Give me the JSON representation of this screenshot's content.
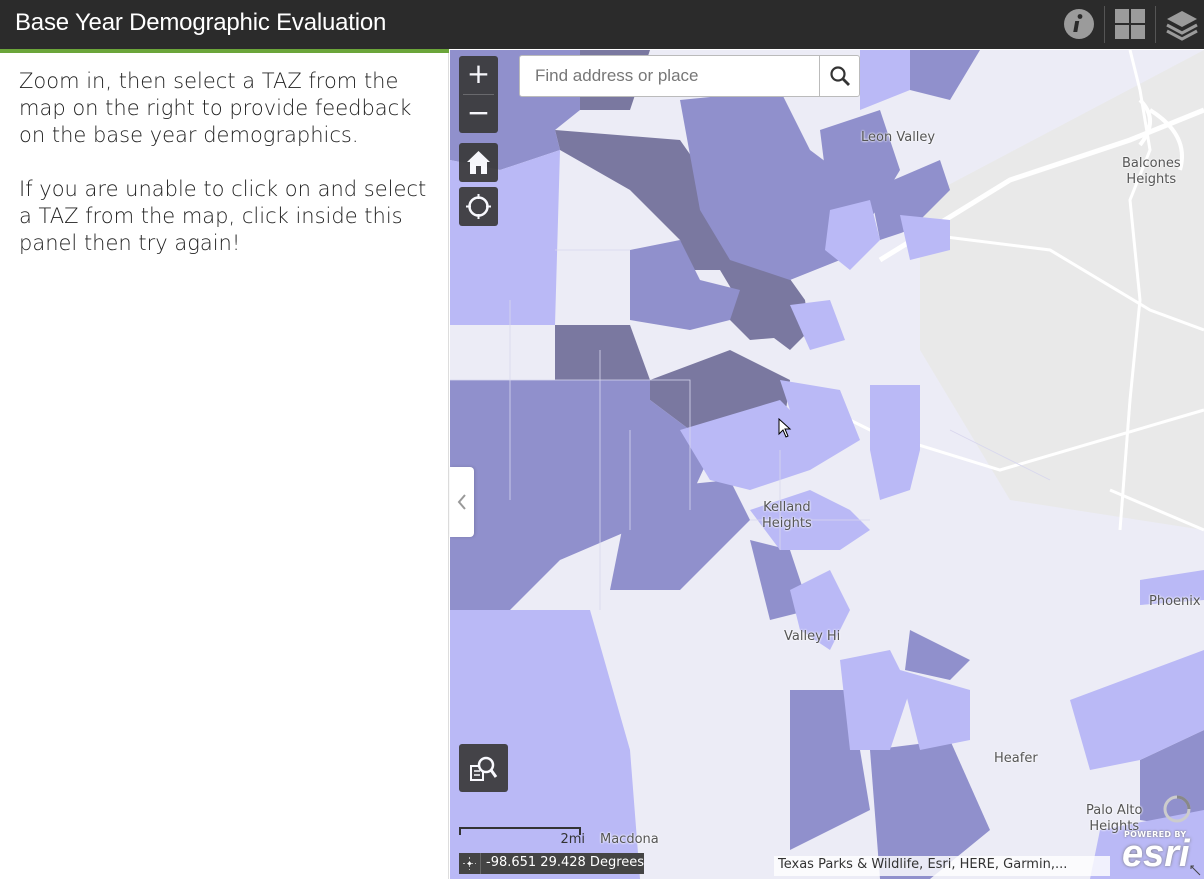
{
  "app": {
    "title": "Base Year Demographic Evaluation"
  },
  "header_icons": [
    "info-icon",
    "grid-icon",
    "layers-icon"
  ],
  "colors": {
    "header_bg": "#2b2b2b",
    "accent": "#6ba53a",
    "choropleth": [
      "#ececf6",
      "#bab9f6",
      "#9090cc",
      "#7a78a0"
    ]
  },
  "panel": {
    "paragraph_1": "Zoom in, then select a TAZ from the map on the right to provide feedback on the base year  demographics.",
    "paragraph_2": "If you are unable to click on and select a TAZ from the map, click inside this panel then try again!"
  },
  "map_controls": {
    "zoom_in": "+",
    "zoom_out": "−",
    "home": "home-icon",
    "locate": "locate-icon",
    "query": "query-icon"
  },
  "search": {
    "placeholder": "Find address or place",
    "value": ""
  },
  "place_labels": {
    "leon_valley": "Leon Valley",
    "balcones_heights": "Balcones\nHeights",
    "kelland_heights": "Kelland\nHeights",
    "valley_hi": "Valley Hi",
    "phoenix": "Phoenix",
    "heafer": "Heafer",
    "palo_alto_heights": "Palo Alto\nHeights",
    "macdona": "Macdona"
  },
  "scale": {
    "label": "2mi"
  },
  "coordinates": {
    "text": "-98.651 29.428 Degrees"
  },
  "attribution": {
    "text": "Texas Parks & Wildlife, Esri, HERE, Garmin,..."
  },
  "logo": {
    "powered_by": "POWERED BY",
    "brand": "esri"
  }
}
